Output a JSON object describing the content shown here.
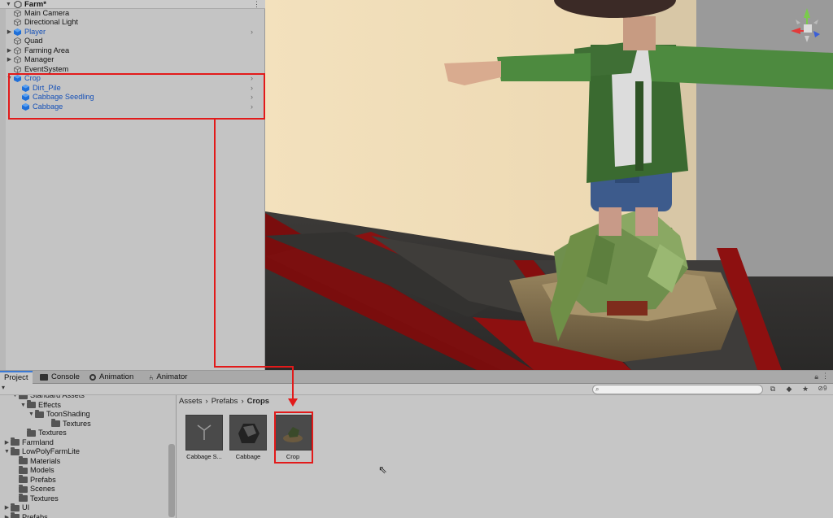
{
  "hierarchy": {
    "scene_name": "Farm*",
    "items": [
      {
        "label": "Main Camera",
        "icon": "gameobject-icon",
        "blue": false,
        "fold": ""
      },
      {
        "label": "Directional Light",
        "icon": "gameobject-icon",
        "blue": false,
        "fold": ""
      },
      {
        "label": "Player",
        "icon": "prefab-icon",
        "blue": true,
        "fold": "right"
      },
      {
        "label": "Quad",
        "icon": "gameobject-icon",
        "blue": false,
        "fold": ""
      },
      {
        "label": "Farming Area",
        "icon": "gameobject-icon",
        "blue": false,
        "fold": "right"
      },
      {
        "label": "Manager",
        "icon": "gameobject-icon",
        "blue": false,
        "fold": "right"
      },
      {
        "label": "EventSystem",
        "icon": "gameobject-icon",
        "blue": false,
        "fold": ""
      },
      {
        "label": "Crop",
        "icon": "prefab-icon",
        "blue": true,
        "fold": "down"
      },
      {
        "label": "Dirt_Pile",
        "icon": "prefab-icon",
        "blue": true,
        "fold": ""
      },
      {
        "label": "Cabbage Seedling",
        "icon": "prefab-icon",
        "blue": true,
        "fold": ""
      },
      {
        "label": "Cabbage",
        "icon": "prefab-icon",
        "blue": true,
        "fold": ""
      }
    ]
  },
  "tabs": [
    {
      "label": "Project",
      "icon": "folder-icon",
      "active": true
    },
    {
      "label": "Console",
      "icon": "console-icon",
      "active": false
    },
    {
      "label": "Animation",
      "icon": "animation-icon",
      "active": false
    },
    {
      "label": "Animator",
      "icon": "animator-icon",
      "active": false
    }
  ],
  "toolbar": {
    "hidden_count": "9"
  },
  "project_tree": [
    {
      "label": "Standard Assets",
      "fold": "down"
    },
    {
      "label": "Effects",
      "fold": "down"
    },
    {
      "label": "ToonShading",
      "fold": "down"
    },
    {
      "label": "Textures",
      "fold": ""
    },
    {
      "label": "Textures",
      "fold": ""
    },
    {
      "label": "Farmland",
      "fold": "right"
    },
    {
      "label": "LowPolyFarmLite",
      "fold": "down"
    },
    {
      "label": "Materials",
      "fold": ""
    },
    {
      "label": "Models",
      "fold": ""
    },
    {
      "label": "Prefabs",
      "fold": ""
    },
    {
      "label": "Scenes",
      "fold": ""
    },
    {
      "label": "Textures",
      "fold": ""
    },
    {
      "label": "UI",
      "fold": "right"
    },
    {
      "label": "Prefabs",
      "fold": "right"
    }
  ],
  "breadcrumb": [
    "Assets",
    "Prefabs",
    "Crops"
  ],
  "assets": [
    {
      "label": "Cabbage S...",
      "selected": false
    },
    {
      "label": "Cabbage",
      "selected": false
    },
    {
      "label": "Crop",
      "selected": true
    }
  ],
  "colors": {
    "annotation": "#e21a1a",
    "prefab_blue": "#1550b7",
    "selection_tab": "#3a79d4"
  }
}
